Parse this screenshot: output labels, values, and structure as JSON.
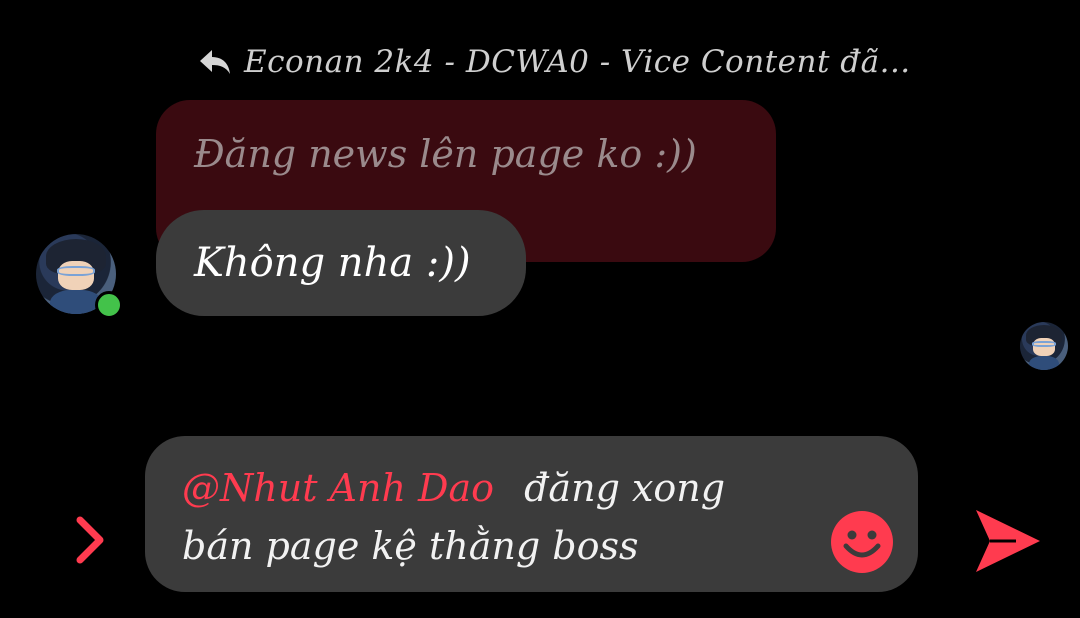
{
  "reply_header": {
    "icon": "reply-arrow-icon",
    "text": "Econan 2k4 - DCWA0 - Vice Content đã..."
  },
  "quoted_message": {
    "text": "Đăng news lên page ko :))"
  },
  "message": {
    "text": "Không nha :))",
    "sender_online": true
  },
  "composer": {
    "mention": "@Nhut Anh Dao",
    "line1_rest": "đăng xong",
    "line2": "bán page kệ thằng boss"
  },
  "icons": {
    "expand": "chevron-right-icon",
    "emoji": "smiley-icon",
    "send": "send-icon"
  },
  "colors": {
    "accent": "#ff3b4f",
    "bubble": "#3b3b3b",
    "quoted_bubble": "#3a0a10",
    "online": "#43c24a"
  }
}
